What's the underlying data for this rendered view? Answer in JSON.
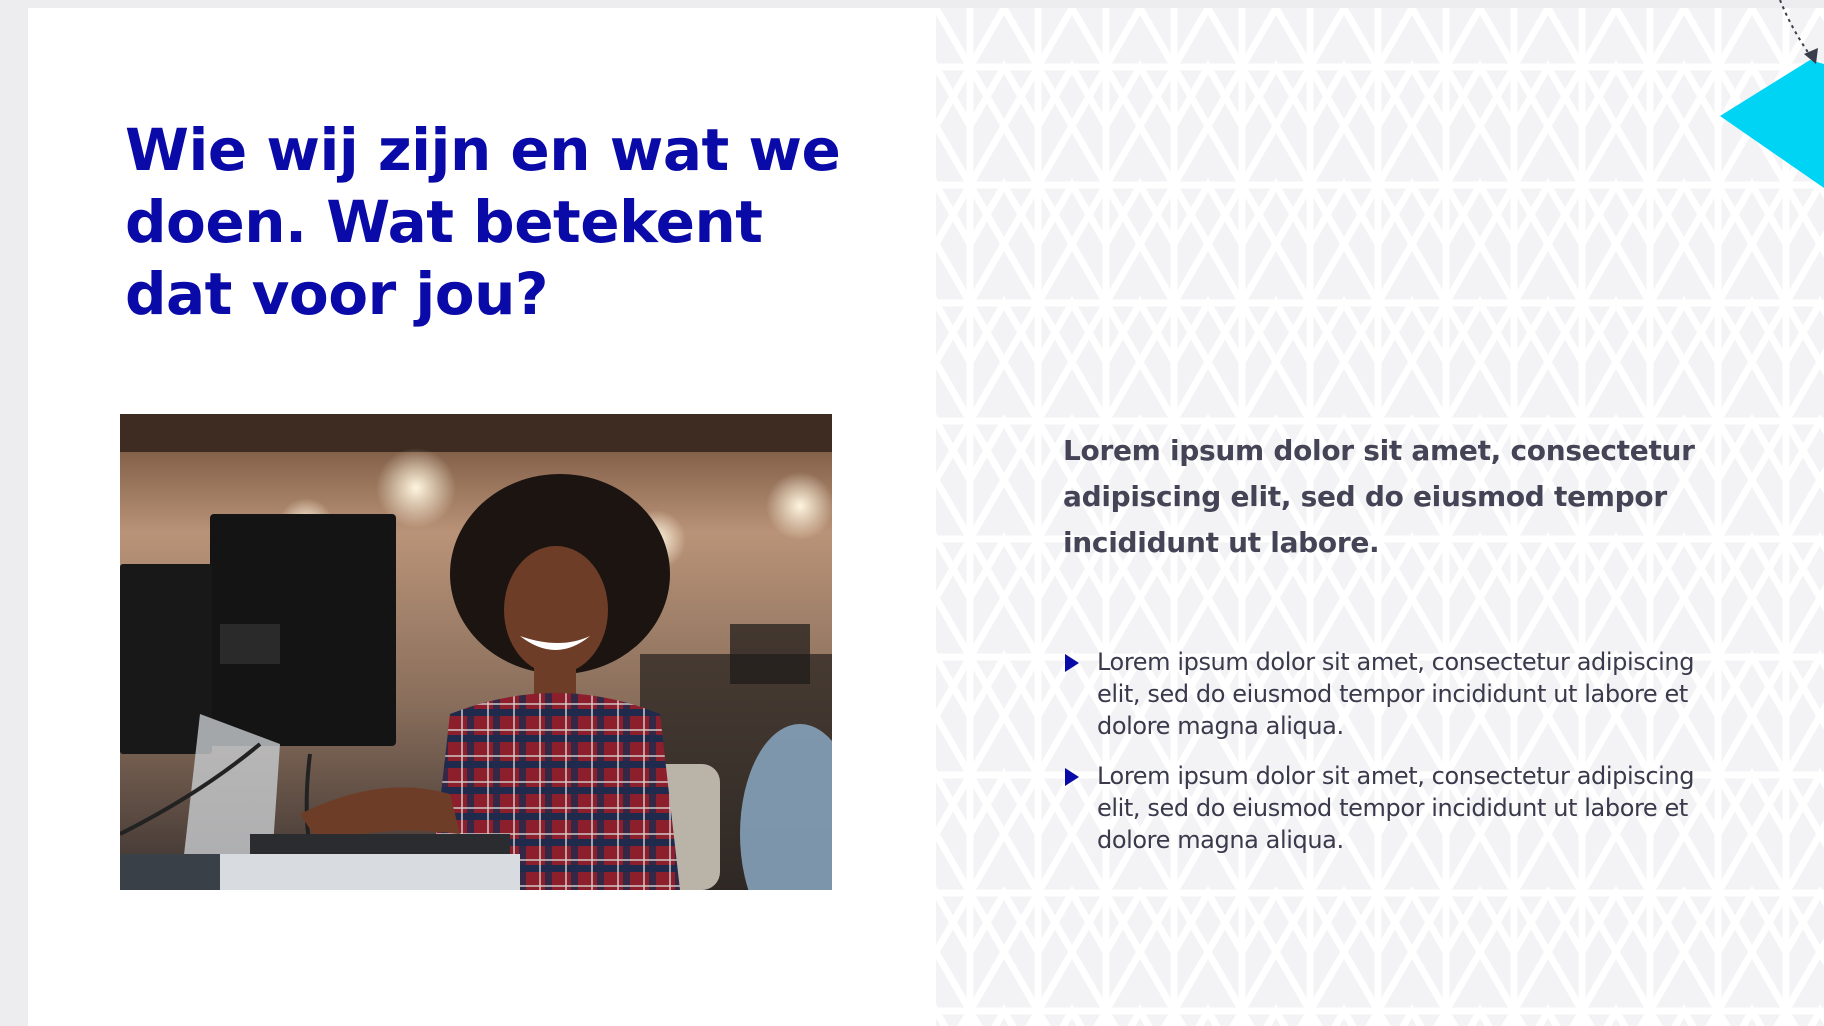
{
  "slide": {
    "title": "Wie wij zijn en wat we doen. Wat betekent dat voor jou?",
    "photo_alt": "Glimlachende vrouw achter computer op kantoor",
    "lead": "Lorem ipsum dolor sit amet, consectetur adipiscing elit, sed do eiusmod tempor incididunt ut labore.",
    "bullets": [
      "Lorem ipsum dolor sit amet, consectetur adipiscing elit, sed do eiusmod tempor incididunt ut labore et dolore magna aliqua.",
      "Lorem ipsum dolor sit amet, consectetur adipiscing elit, sed do eiusmod tempor incididunt ut labore et dolore magna aliqua."
    ]
  },
  "colors": {
    "title": "#0a0aa8",
    "body_text": "#3a3a4c",
    "bullet_marker": "#0a0aa8",
    "accent_cyan": "#00d4f5",
    "pattern_bg": "#f6f6f7",
    "pattern_line": "#ffffff"
  },
  "icons": {
    "bullet": "play-triangle-icon",
    "decoration": "cyan-diamond-with-arrow"
  }
}
